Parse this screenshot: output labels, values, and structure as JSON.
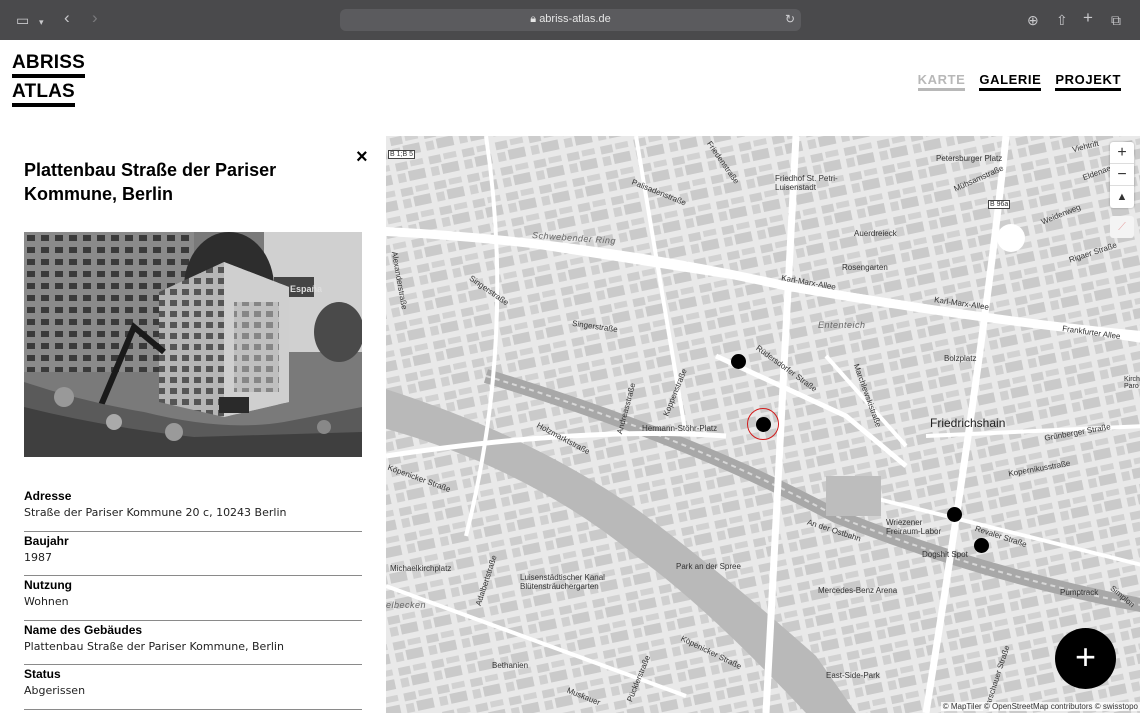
{
  "browser": {
    "url": "abriss-atlas.de"
  },
  "logo": {
    "line1": "ABRISS",
    "line2": "ATLAS"
  },
  "nav": [
    {
      "label": "KARTE",
      "active": true
    },
    {
      "label": "GALERIE",
      "active": false
    },
    {
      "label": "PROJEKT",
      "active": false
    }
  ],
  "panel": {
    "title": "Plattenbau Straße der Pariser Kommune, Berlin",
    "close_icon": "×",
    "photo_sign": "España",
    "fields": [
      {
        "label": "Adresse",
        "value": "Straße der Pariser Kommune 20 c, 10243 Berlin"
      },
      {
        "label": "Baujahr",
        "value": "1987"
      },
      {
        "label": "Nutzung",
        "value": "Wohnen"
      },
      {
        "label": "Name des Gebäudes",
        "value": "Plattenbau Straße der Pariser Kommune, Berlin"
      },
      {
        "label": "Status",
        "value": "Abgerissen"
      }
    ]
  },
  "map": {
    "labels": {
      "b15": "B 1;B 5",
      "friedhof": "Friedhof St. Petri-\nLuisenstadt",
      "petersburger": "Petersburger Platz",
      "b96a": "B 96a",
      "schwebender": "Schwebender Ring",
      "auerdreieck": "Auerdreieck",
      "rosengarten": "Rosengarten",
      "karl_marx": "Karl-Marx-Allee",
      "karl_marx2": "Karl-Marx-Allee",
      "frankfurter": "Frankfurter Allee",
      "singer1": "Singerstraße",
      "singer2": "Singerstraße",
      "ententeich": "Ententeich",
      "bolzplatz": "Bolzplatz",
      "friedrichshain": "Friedrichshain",
      "hermann": "Hermann-Stöhr-Platz",
      "ruedersdorfer": "Rüdersdorfer Straße",
      "marchlewski": "Marchlewskistraße",
      "gruenberger": "Grünberger Straße",
      "kopernikus": "Kopernikusstraße",
      "holzmarkt": "Holzmarktstraße",
      "koepenicker": "Köpenicker Straße",
      "wriezener": "Wriezener\nFreiraum-Labor",
      "dogshit": "Dogshit Spot",
      "revaler": "Revaler Straße",
      "an_der_ostbahn": "An der Ostbahn",
      "michaelkirch": "Michaelkirchplatz",
      "luisenstaedt": "Luisenstädtischer Kanal\nBlütensträuchergarten",
      "park_spree": "Park an der Spree",
      "mercedes": "Mercedes-Benz Arena",
      "pumptrack": "Pumptrack",
      "bethanien": "Bethanien",
      "east_side": "East-Side-Park",
      "kirch": "Kirch\nParo",
      "alexander": "Alexanderstraße",
      "andreas": "Andreasstraße",
      "koppen": "Koppenstraße",
      "palisaden": "Palisadenstraße",
      "friedenstr": "Friedenstraße",
      "weidenweg": "Weidenweg",
      "rigaer": "Rigaer Straße",
      "muehsam": "Mühsamstraße",
      "eldenaer": "Eldenaer",
      "viehtrift": "Viehtrift",
      "adalbert": "Adalbertstraße",
      "mueskauer": "Muskauer",
      "puckler": "Pücklerstraße",
      "koepenicker2": "Köpenicker Straße",
      "elbecken": "elbecken",
      "warschauer": "Warschauer Straße",
      "simplon": "Simplon"
    },
    "zoom_in": "+",
    "zoom_out": "−",
    "north": "▲",
    "attribution": "© MapTiler © OpenStreetMap contributors © swisstopo",
    "fab_label": "+"
  }
}
